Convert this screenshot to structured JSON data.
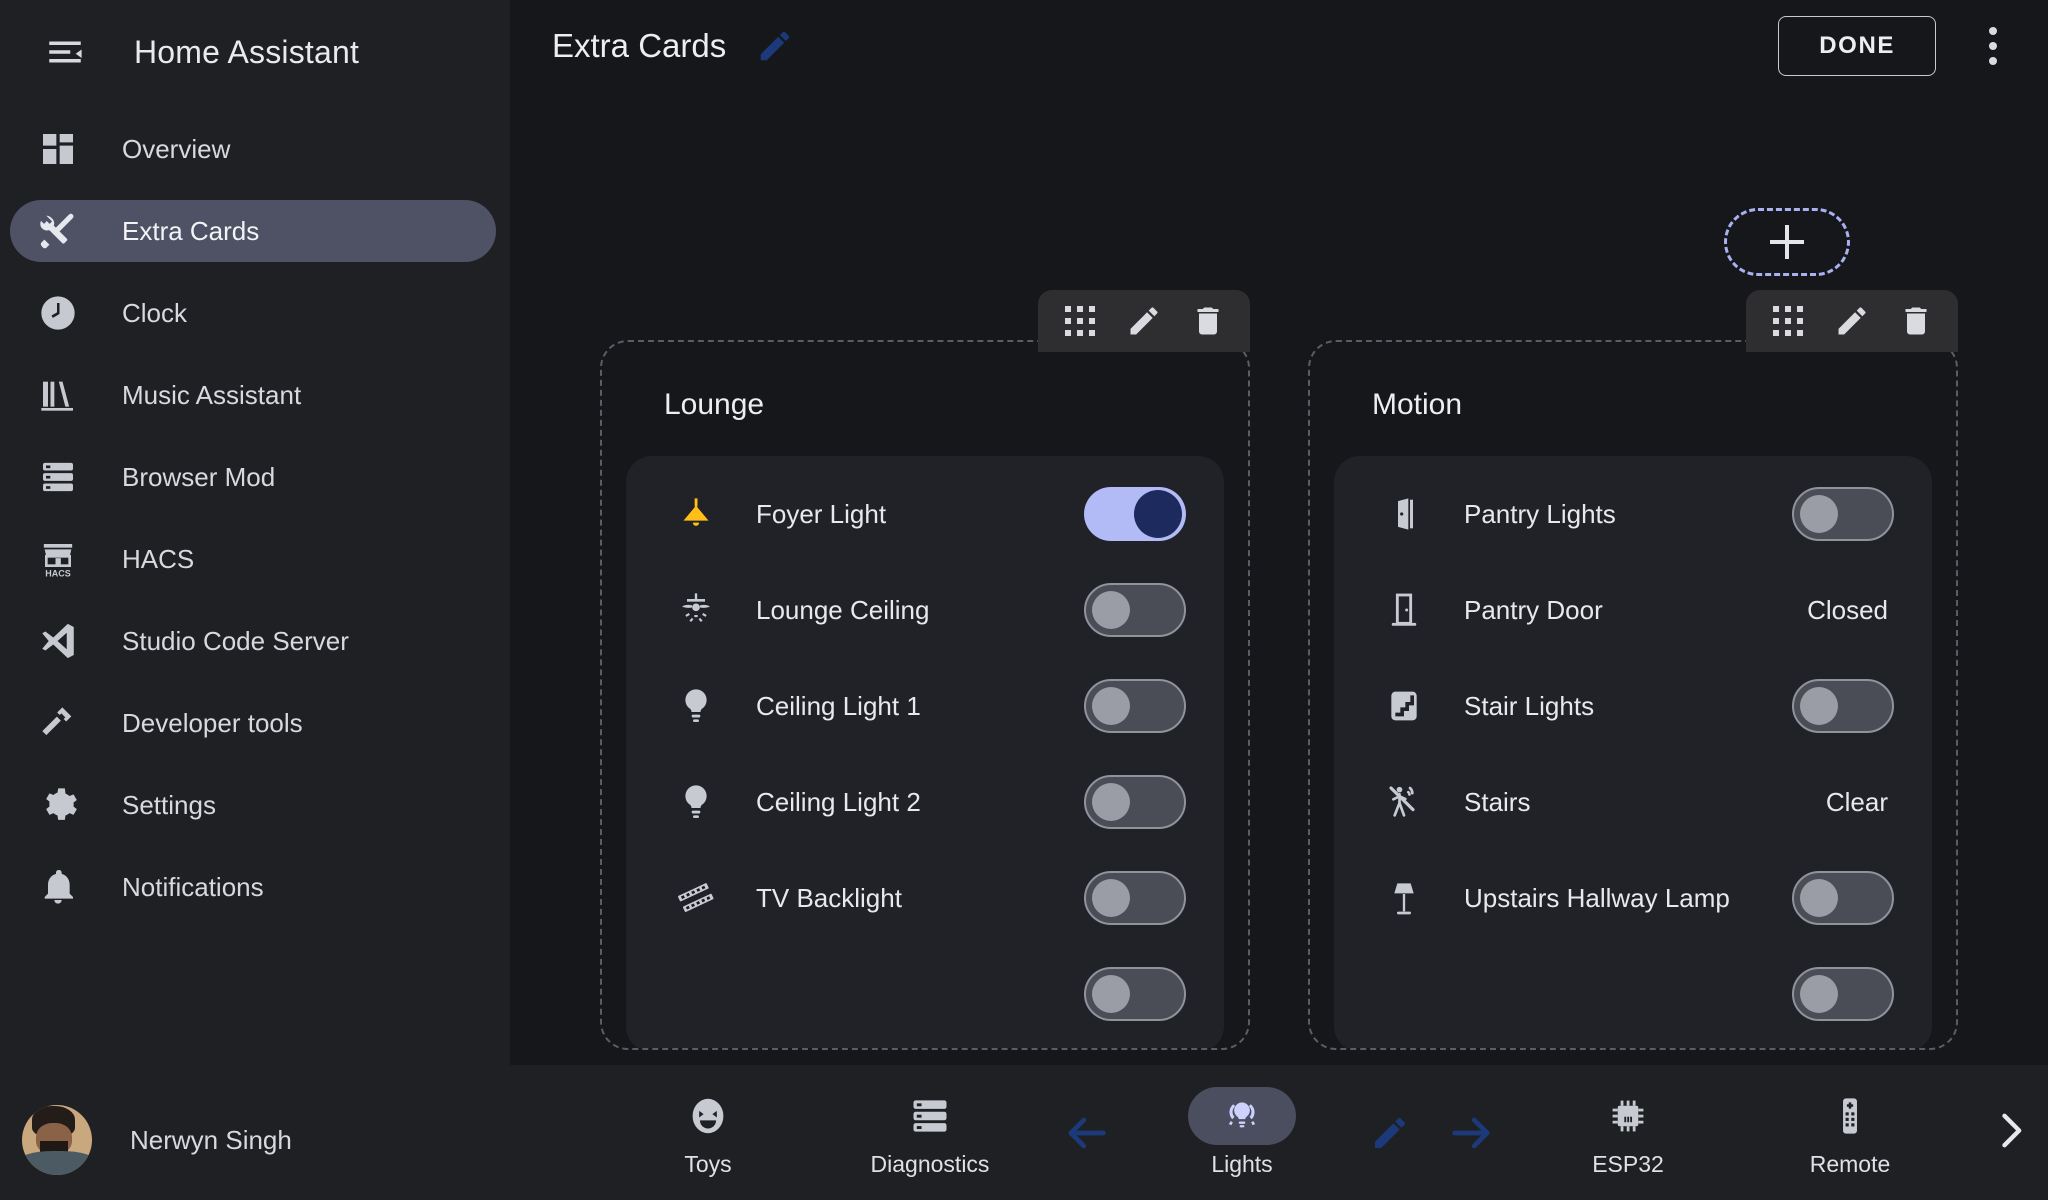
{
  "sidebar": {
    "title": "Home Assistant",
    "menu_icon": "menu-collapse-icon",
    "items": [
      {
        "label": "Overview",
        "icon": "view-dashboard-icon",
        "active": false
      },
      {
        "label": "Extra Cards",
        "icon": "tools-icon",
        "active": true
      },
      {
        "label": "Clock",
        "icon": "clock-icon",
        "active": false
      },
      {
        "label": "Music Assistant",
        "icon": "bookshelf-icon",
        "active": false
      },
      {
        "label": "Browser Mod",
        "icon": "server-icon",
        "active": false
      },
      {
        "label": "HACS",
        "icon": "hacs-store-icon",
        "active": false
      },
      {
        "label": "Studio Code Server",
        "icon": "vscode-icon",
        "active": false
      },
      {
        "label": "Developer tools",
        "icon": "hammer-icon",
        "active": false
      },
      {
        "label": "Settings",
        "icon": "gear-icon",
        "active": false
      },
      {
        "label": "Notifications",
        "icon": "bell-icon",
        "active": false
      }
    ],
    "user": {
      "name": "Nerwyn Singh",
      "avatar": "user-avatar"
    }
  },
  "topbar": {
    "title": "Extra Cards",
    "edit_icon": "pencil-icon",
    "done_label": "DONE",
    "overflow_icon": "more-vertical-icon"
  },
  "add_card": {
    "icon": "plus-icon",
    "label": ""
  },
  "card_toolbar": {
    "drag_icon": "drag-dots-icon",
    "edit_icon": "pencil-icon",
    "delete_icon": "trash-icon"
  },
  "cards": [
    {
      "title": "Lounge",
      "rows": [
        {
          "name": "Foyer Light",
          "icon": "ceiling-light-icon",
          "icon_color": "#ffbf17",
          "control": "toggle",
          "on": true
        },
        {
          "name": "Lounge Ceiling",
          "icon": "ceiling-fan-light-icon",
          "icon_color": "#c8cad2",
          "control": "toggle",
          "on": false
        },
        {
          "name": "Ceiling Light 1",
          "icon": "lightbulb-icon",
          "icon_color": "#c8cad2",
          "control": "toggle",
          "on": false
        },
        {
          "name": "Ceiling Light 2",
          "icon": "lightbulb-icon",
          "icon_color": "#c8cad2",
          "control": "toggle",
          "on": false
        },
        {
          "name": "TV Backlight",
          "icon": "led-strip-icon",
          "icon_color": "#c8cad2",
          "control": "toggle",
          "on": false
        }
      ]
    },
    {
      "title": "Motion",
      "rows": [
        {
          "name": "Pantry Lights",
          "icon": "door-open-icon",
          "icon_color": "#c8cad2",
          "control": "toggle",
          "on": false
        },
        {
          "name": "Pantry Door",
          "icon": "door-closed-icon",
          "icon_color": "#c8cad2",
          "control": "state",
          "state": "Closed"
        },
        {
          "name": "Stair Lights",
          "icon": "stairs-icon",
          "icon_color": "#c8cad2",
          "control": "toggle",
          "on": false
        },
        {
          "name": "Stairs",
          "icon": "motion-off-icon",
          "icon_color": "#c8cad2",
          "control": "state",
          "state": "Clear"
        },
        {
          "name": "Upstairs Hallway Lamp",
          "icon": "floor-lamp-icon",
          "icon_color": "#c8cad2",
          "control": "toggle",
          "on": false
        }
      ]
    }
  ],
  "bottom_nav": {
    "items": [
      {
        "label": "Toys",
        "icon": "emoticon-icon",
        "active": false
      },
      {
        "label": "Diagnostics",
        "icon": "server-icon",
        "active": false
      },
      {
        "label": "Lights",
        "icon": "lightbulb-group-icon",
        "active": true
      },
      {
        "label": "ESP32",
        "icon": "chip-icon",
        "active": false
      },
      {
        "label": "Remote",
        "icon": "remote-icon",
        "active": false
      }
    ],
    "prev_icon": "arrow-left-icon",
    "next_icon": "arrow-right-icon",
    "edit_icon": "pencil-icon",
    "overflow_icon": "chevron-right-icon"
  },
  "colors": {
    "accent_blue": "#1c3a7a",
    "active_lavender": "#b3bbf7",
    "sidebar_bg": "#1f2023",
    "main_bg": "#16171b",
    "card_inner": "#202227",
    "light_on": "#ffbf17"
  }
}
